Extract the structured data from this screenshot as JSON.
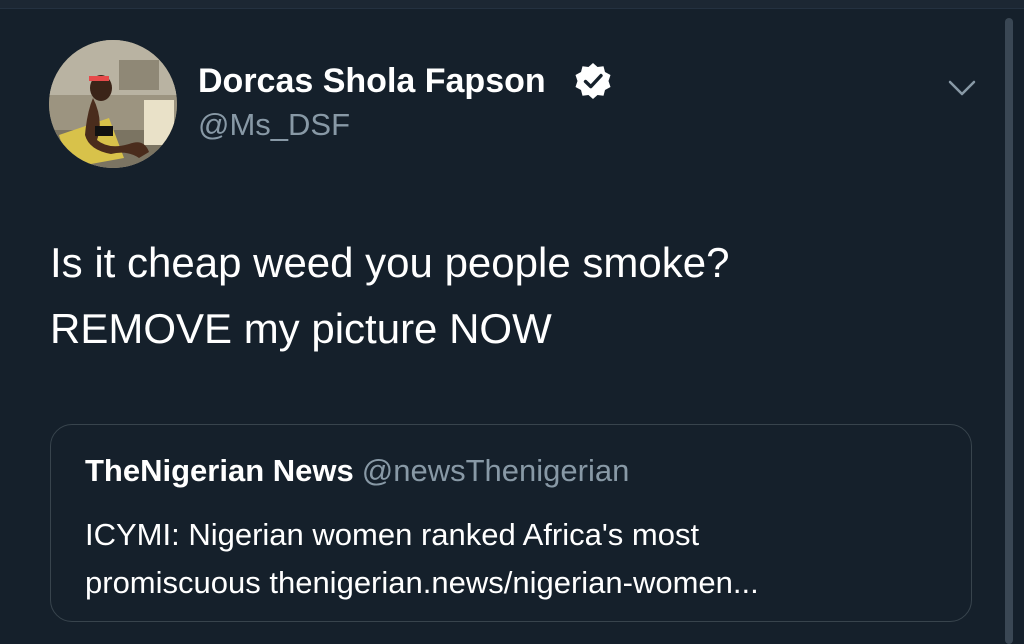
{
  "tweet": {
    "display_name": "Dorcas Shola Fapson",
    "handle": "@Ms_DSF",
    "text_lines": [
      "Is it cheap weed you people smoke?",
      "REMOVE my picture NOW"
    ]
  },
  "quoted_tweet": {
    "name": "TheNigerian News",
    "handle": "@newsThenigerian",
    "text_lines": [
      "ICYMI: Nigerian women ranked Africa's most",
      "promiscuous thenigerian.news/nigerian-women..."
    ]
  },
  "icons": {
    "verified": "verified-badge-icon",
    "menu": "chevron-down-icon"
  },
  "colors": {
    "background": "#15202b",
    "secondary_text": "#8899a6",
    "border": "#38444d"
  }
}
